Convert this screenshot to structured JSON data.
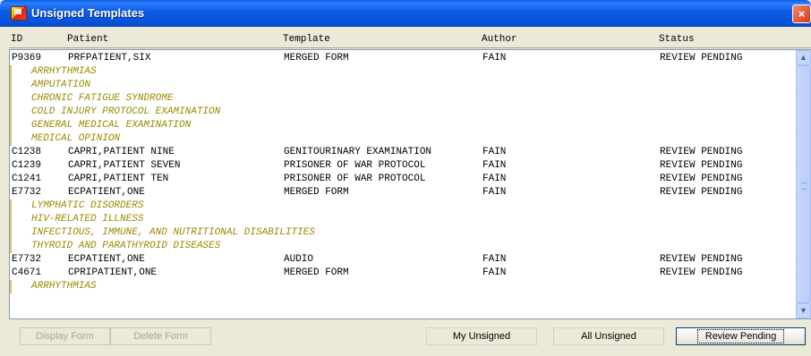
{
  "window": {
    "title": "Unsigned Templates",
    "close_label": "×"
  },
  "columns": [
    "ID",
    "Patient",
    "Template",
    "Author",
    "Status"
  ],
  "rows": [
    {
      "id": "P9369",
      "patient": "PRFPATIENT,SIX",
      "template": "MERGED FORM",
      "author": "FAIN",
      "status": "REVIEW PENDING",
      "subs": [
        "ARRHYTHMIAS",
        "AMPUTATION",
        "CHRONIC FATIGUE SYNDROME",
        "COLD INJURY PROTOCOL EXAMINATION",
        "GENERAL MEDICAL EXAMINATION",
        "MEDICAL OPINION"
      ]
    },
    {
      "id": "C1238",
      "patient": "CAPRI,PATIENT NINE",
      "template": "GENITOURINARY EXAMINATION",
      "author": "FAIN",
      "status": "REVIEW PENDING",
      "subs": []
    },
    {
      "id": "C1239",
      "patient": "CAPRI,PATIENT SEVEN",
      "template": "PRISONER OF WAR PROTOCOL",
      "author": "FAIN",
      "status": "REVIEW PENDING",
      "subs": []
    },
    {
      "id": "C1241",
      "patient": "CAPRI,PATIENT TEN",
      "template": "PRISONER OF WAR PROTOCOL",
      "author": "FAIN",
      "status": "REVIEW PENDING",
      "subs": []
    },
    {
      "id": "E7732",
      "patient": "ECPATIENT,ONE",
      "template": "MERGED FORM",
      "author": "FAIN",
      "status": "REVIEW PENDING",
      "subs": [
        "LYMPHATIC DISORDERS",
        "HIV-RELATED ILLNESS",
        "INFECTIOUS, IMMUNE, AND NUTRITIONAL DISABILITIES",
        "THYROID AND PARATHYROID DISEASES"
      ]
    },
    {
      "id": "E7732",
      "patient": "ECPATIENT,ONE",
      "template": "AUDIO",
      "author": "FAIN",
      "status": "REVIEW PENDING",
      "subs": []
    },
    {
      "id": "C4671",
      "patient": "CPRIPATIENT,ONE",
      "template": "MERGED FORM",
      "author": "FAIN",
      "status": "REVIEW PENDING",
      "subs": [
        "ARRHYTHMIAS"
      ]
    }
  ],
  "scrollbar": {
    "up_icon": "chevron-up-icon",
    "down_icon": "chevron-down-icon",
    "up_glyph": "▲",
    "down_glyph": "▼"
  },
  "buttons": {
    "display_form": "Display Form",
    "delete_form": "Delete Form",
    "my_unsigned": "My Unsigned",
    "all_unsigned": "All Unsigned",
    "review_pending": "Review Pending"
  }
}
